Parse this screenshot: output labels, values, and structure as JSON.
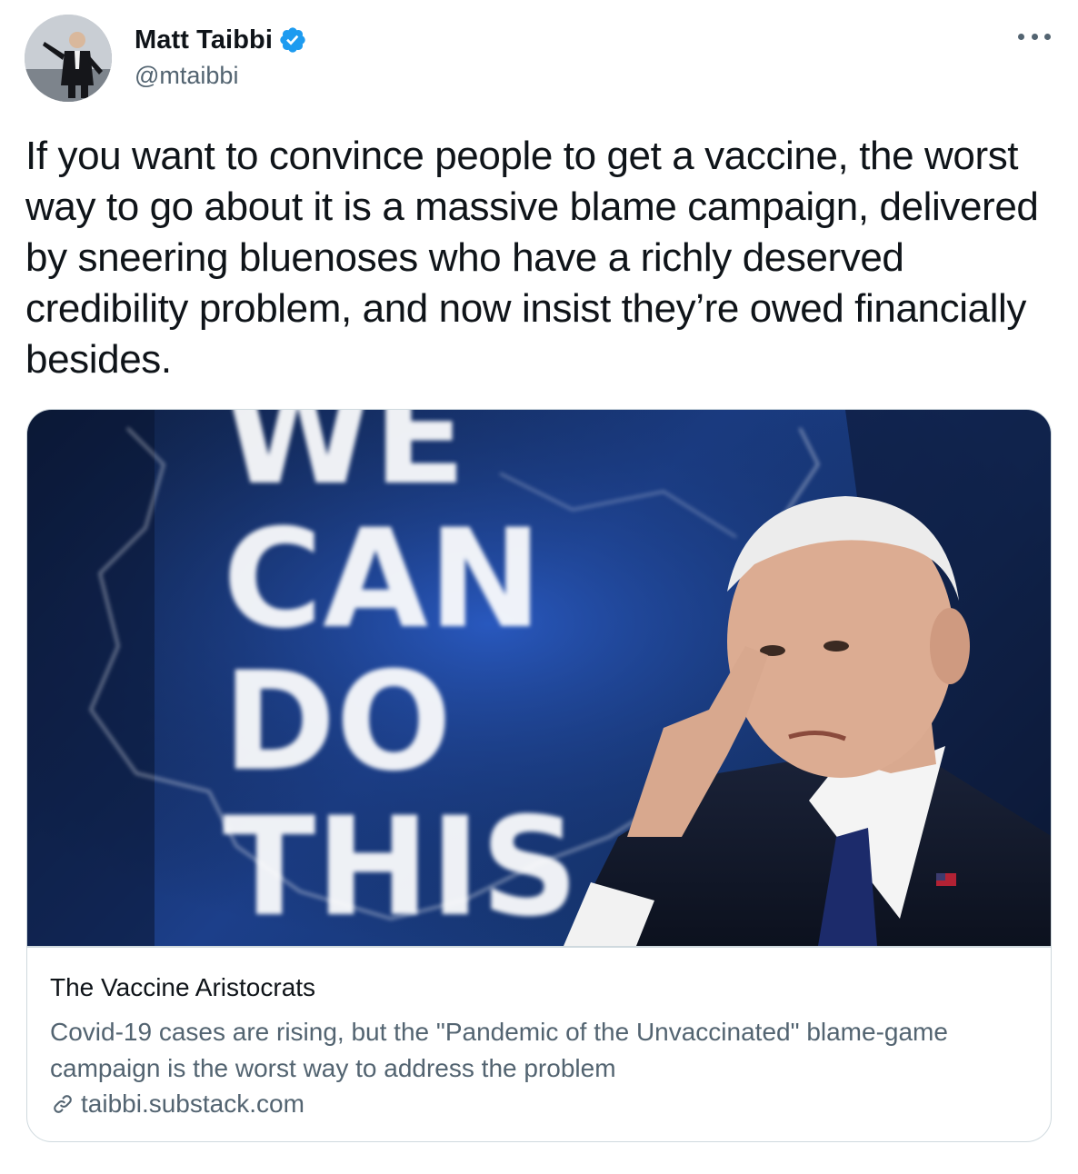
{
  "author": {
    "display_name": "Matt Taibbi",
    "handle": "@mtaibbi",
    "verified": true,
    "verified_icon": "verified-badge-icon"
  },
  "more_icon": "more-options-icon",
  "tweet": {
    "text": "If you want to convince people to get a vaccine, the worst way to go about it is a massive blame campaign, delivered by sneering bluenoses who have a richly deserved credibility problem, and now insist they’re owed financially besides."
  },
  "card": {
    "image_sign_lines": [
      "WE",
      "CAN",
      "DO",
      "THIS"
    ],
    "title": "The Vaccine Aristocrats",
    "description": "Covid-19 cases are rising, but the \"Pandemic of the Unvaccinated\" blame-game campaign is the worst way to address the problem",
    "domain": "taibbi.substack.com",
    "domain_icon": "link-icon"
  },
  "colors": {
    "text_primary": "#0f1419",
    "text_secondary": "#536471",
    "verified_blue": "#1d9bf0",
    "card_border": "#cfd9de"
  }
}
